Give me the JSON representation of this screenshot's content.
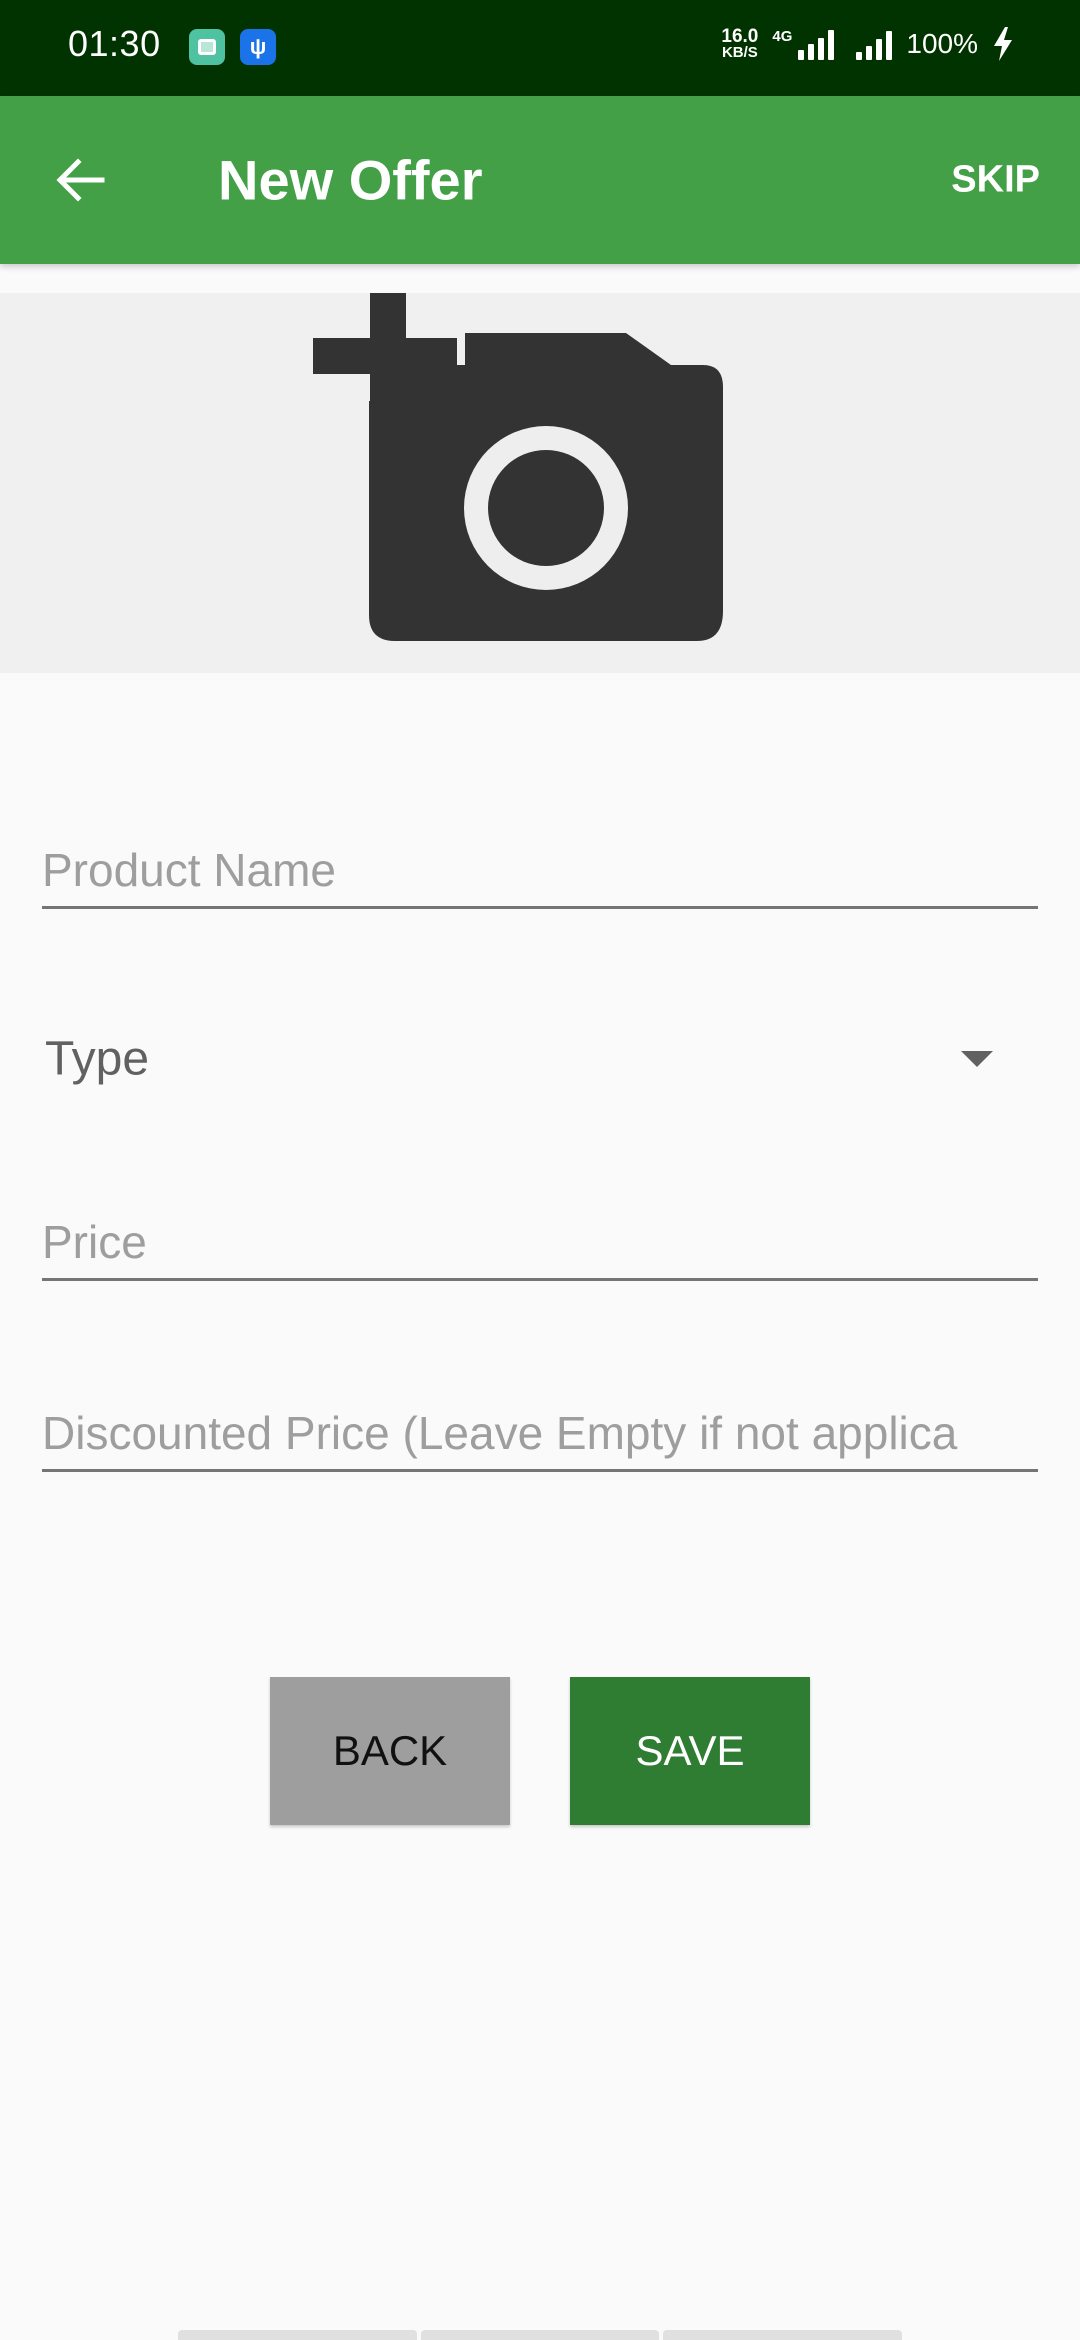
{
  "status_bar": {
    "time": "01:30",
    "net_speed_value": "16.0",
    "net_speed_unit": "KB/S",
    "network_type": "4G",
    "battery": "100%",
    "icons": [
      "gallery-app-icon",
      "usb-icon",
      "signal-4g-icon",
      "signal-icon",
      "charging-icon"
    ]
  },
  "app_bar": {
    "title": "New Offer",
    "skip_label": "SKIP",
    "back_icon": "arrow-left-icon",
    "color": "#43a047"
  },
  "photo": {
    "icon": "add-a-photo-icon"
  },
  "form": {
    "product_name_placeholder": "Product Name",
    "type_label": "Type",
    "price_placeholder": "Price",
    "discounted_price_placeholder": "Discounted Price (Leave Empty if not applica"
  },
  "buttons": {
    "back_label": "BACK",
    "save_label": "SAVE",
    "save_color": "#2e7d32",
    "back_color": "#9e9e9e"
  }
}
